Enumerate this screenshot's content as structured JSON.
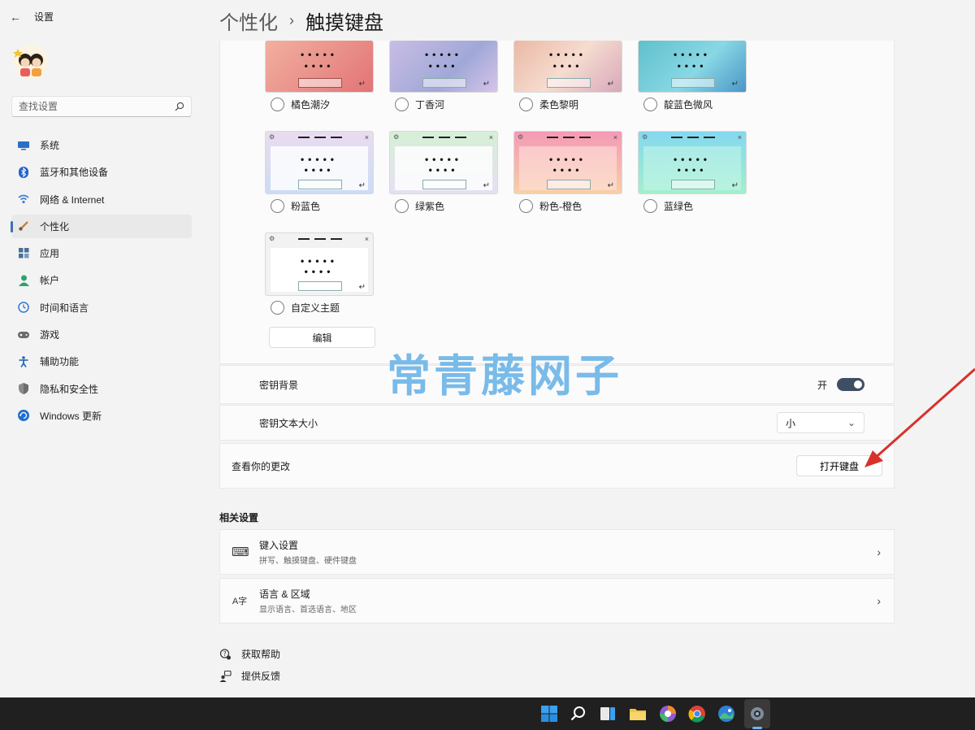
{
  "window": {
    "app_title": "设置"
  },
  "search": {
    "placeholder": "查找设置"
  },
  "sidebar": {
    "items": [
      {
        "label": "系统",
        "icon": "monitor-icon",
        "color": "#2b6ec7"
      },
      {
        "label": "蓝牙和其他设备",
        "icon": "bluetooth-icon",
        "color": "#2563c9"
      },
      {
        "label": "网络 & Internet",
        "icon": "wifi-icon",
        "color": "#3f7fd6"
      },
      {
        "label": "个性化",
        "icon": "brush-icon",
        "color": "#c4833b",
        "active": true
      },
      {
        "label": "应用",
        "icon": "apps-icon",
        "color": "#4a6f95"
      },
      {
        "label": "帐户",
        "icon": "person-icon",
        "color": "#2ea36b"
      },
      {
        "label": "时间和语言",
        "icon": "globe-clock-icon",
        "color": "#2f79c9"
      },
      {
        "label": "游戏",
        "icon": "gamepad-icon",
        "color": "#6b6b6b"
      },
      {
        "label": "辅助功能",
        "icon": "accessibility-icon",
        "color": "#2466b8"
      },
      {
        "label": "隐私和安全性",
        "icon": "shield-icon",
        "color": "#777777"
      },
      {
        "label": "Windows 更新",
        "icon": "update-icon",
        "color": "#1f6fd1"
      }
    ]
  },
  "breadcrumb": {
    "parent": "个性化",
    "separator": "›",
    "current": "触摸键盘"
  },
  "themes": [
    {
      "label": "橘色潮汐",
      "colors": [
        "#f0a090",
        "#e86f6f"
      ]
    },
    {
      "label": "丁香河",
      "colors": [
        "#c7b9e0",
        "#9aa6d6"
      ]
    },
    {
      "label": "柔色黎明",
      "colors": [
        "#e8b8a8",
        "#d5a0b4"
      ]
    },
    {
      "label": "靛蓝色微风",
      "colors": [
        "#6fc6d2",
        "#4f9ed0"
      ]
    },
    {
      "label": "粉蓝色",
      "colors": [
        "#e8d8ee",
        "#c8dcf4"
      ]
    },
    {
      "label": "绿紫色",
      "colors": [
        "#d8f0d8",
        "#e4dcf2"
      ]
    },
    {
      "label": "粉色-橙色",
      "colors": [
        "#f4a0b8",
        "#f8c8a0"
      ]
    },
    {
      "label": "蓝绿色",
      "colors": [
        "#86d8ec",
        "#9ef0cc"
      ]
    },
    {
      "label": "自定义主题",
      "colors": [
        "#f2f2f2",
        "#ffffff"
      ]
    }
  ],
  "thumb_text": {
    "gear": "⚙",
    "close": "×",
    "dots1": "•••••",
    "dots2": "••••",
    "enter": "↵"
  },
  "edit_button": "编辑",
  "key_background": {
    "label": "密钥背景",
    "state": "开"
  },
  "key_text_size": {
    "label": "密钥文本大小",
    "value": "小",
    "chevron": "⌄"
  },
  "preview": {
    "label": "查看你的更改",
    "button": "打开键盘"
  },
  "related": {
    "title": "相关设置",
    "items": [
      {
        "title": "键入设置",
        "subtitle": "拼写、触摸键盘、硬件键盘",
        "icon": "keyboard-icon",
        "glyph": "⌨"
      },
      {
        "title": "语言 & 区域",
        "subtitle": "显示语言、首选语言、地区",
        "icon": "language-icon",
        "glyph": "A字"
      }
    ],
    "chevron": "›"
  },
  "help": {
    "get_help": "获取帮助",
    "feedback": "提供反馈"
  },
  "watermark": "常青藤网子"
}
